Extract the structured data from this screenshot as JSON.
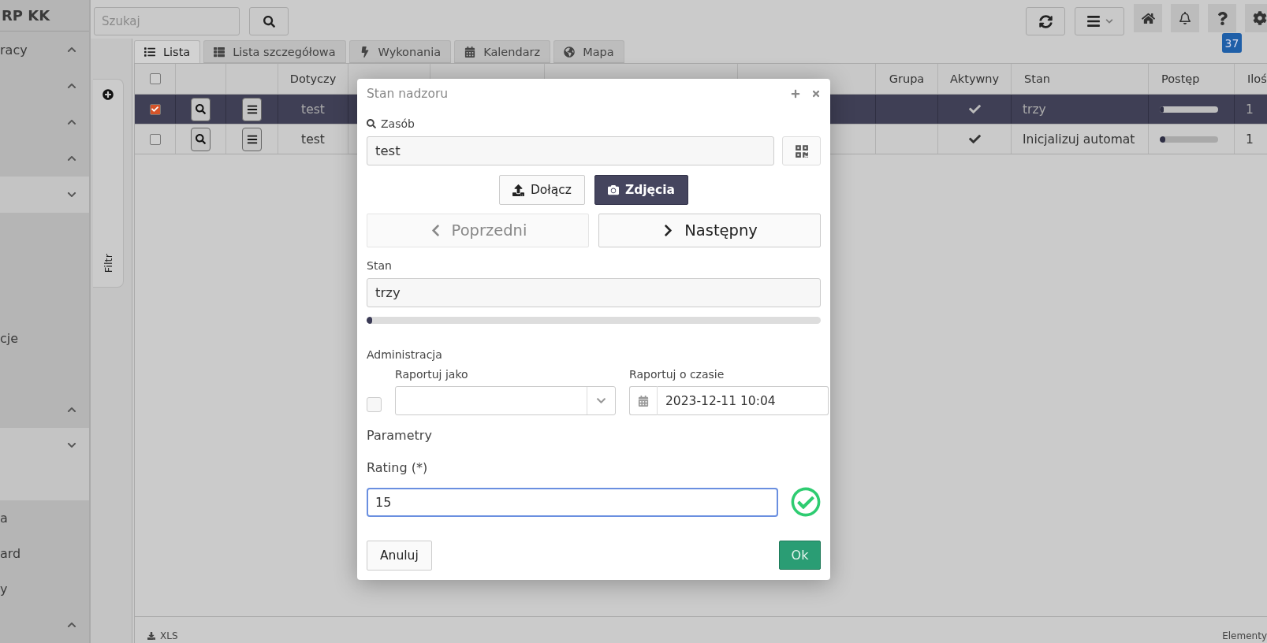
{
  "topbar": {
    "search": {
      "placeholder": "Szukaj"
    },
    "badge": "37"
  },
  "sidebar": {
    "brand": "RP KK",
    "items": [
      {
        "label": "racy",
        "expanded": false
      },
      {
        "expanded": false
      },
      {
        "expanded": false
      },
      {
        "expanded": false
      },
      {
        "expanded": true,
        "children": [
          {
            "label": "cje"
          }
        ]
      },
      {
        "expanded": false
      },
      {
        "expanded": true,
        "children": [
          {
            "label": "a"
          },
          {
            "label": "ard"
          },
          {
            "label": "y"
          }
        ]
      },
      {
        "expanded": false
      }
    ]
  },
  "filter_tab": {
    "label": "Filtr"
  },
  "tabs": [
    {
      "label": "Lista",
      "selected": true
    },
    {
      "label": "Lista szczegółowa",
      "selected": false
    },
    {
      "label": "Wykonania",
      "selected": false
    },
    {
      "label": "Kalendarz",
      "selected": false
    },
    {
      "label": "Mapa",
      "selected": false
    }
  ],
  "table": {
    "all_checked": false,
    "columns": [
      "Dotyczy",
      "Grupa",
      "Aktywny",
      "Stan",
      "Postęp",
      "Iloś"
    ],
    "rows": [
      {
        "selected": true,
        "checked": true,
        "subject": "test",
        "active": true,
        "state": "trzy",
        "level": 0.02,
        "quantity": "1"
      },
      {
        "selected": false,
        "checked": false,
        "subject": "test",
        "active": true,
        "state": "Inicjalizuj automat",
        "level": 0.1,
        "quantity": "1"
      }
    ]
  },
  "footer": {
    "export": "XLS",
    "count_label": "Elementy"
  },
  "dialog": {
    "title": "Stan nadzoru",
    "resource": {
      "label": "Zasób",
      "value": "test"
    },
    "attach_button": "Dołącz",
    "photos_button": "Zdjęcia",
    "prev_button": {
      "label": "Poprzedni",
      "disabled": true
    },
    "next_button": {
      "label": "Następny",
      "disabled": false
    },
    "state": {
      "label": "Stan",
      "value": "trzy",
      "level": 0.01
    },
    "admin": {
      "title": "Administracja",
      "checked": false,
      "report_as": {
        "label": "Raportuj jako"
      },
      "report_time": {
        "label": "Raportuj o czasie",
        "value": "2023-12-11 10:04"
      }
    },
    "params_title": "Parametry",
    "rating": {
      "label": "Rating (*)",
      "value": "15",
      "valid": true
    },
    "cancel_button": "Anuluj",
    "ok_button": "Ok"
  }
}
